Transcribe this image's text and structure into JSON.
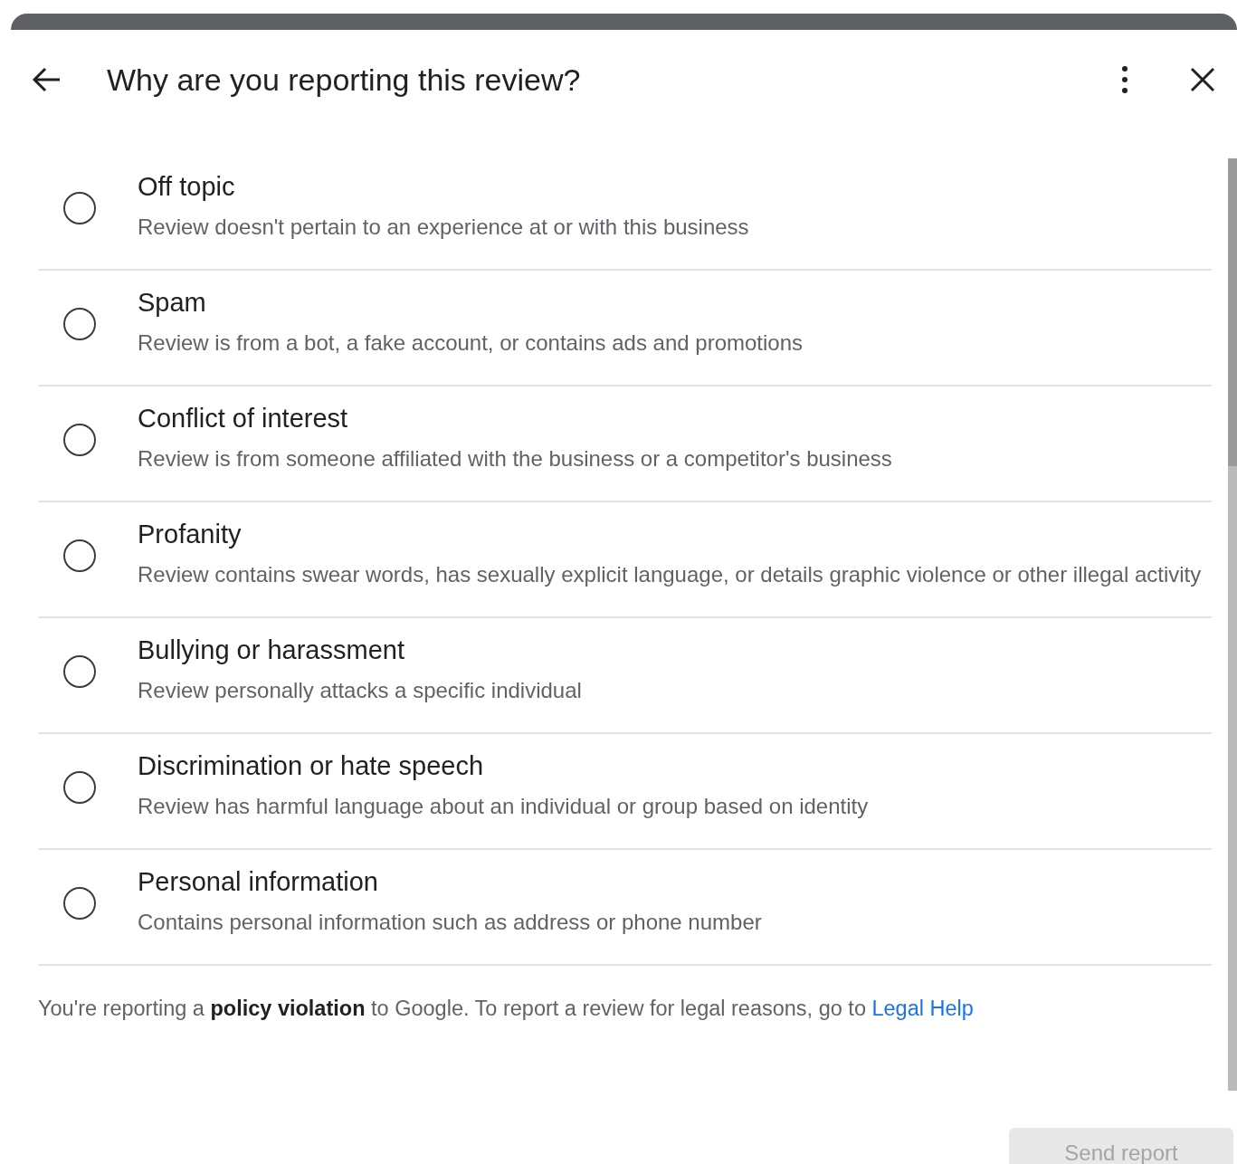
{
  "dialog": {
    "title": "Why are you reporting this review?"
  },
  "options": [
    {
      "label": "Off topic",
      "description": "Review doesn't pertain to an experience at or with this business",
      "selected": false
    },
    {
      "label": "Spam",
      "description": "Review is from a bot, a fake account, or contains ads and promotions",
      "selected": false
    },
    {
      "label": "Conflict of interest",
      "description": "Review is from someone affiliated with the business or a competitor's business",
      "selected": false
    },
    {
      "label": "Profanity",
      "description": "Review contains swear words, has sexually explicit language, or details graphic violence or other illegal activity",
      "selected": false
    },
    {
      "label": "Bullying or harassment",
      "description": "Review personally attacks a specific individual",
      "selected": false
    },
    {
      "label": "Discrimination or hate speech",
      "description": "Review has harmful language about an individual or group based on identity",
      "selected": false
    },
    {
      "label": "Personal information",
      "description": "Contains personal information such as address or phone number",
      "selected": false
    }
  ],
  "notice": {
    "text": "You're reporting a **policy violation** to Google. To report a review for legal reasons, go to",
    "link": "Legal Help"
  },
  "submit_button": {
    "label": "Send report",
    "disabled": true
  }
}
